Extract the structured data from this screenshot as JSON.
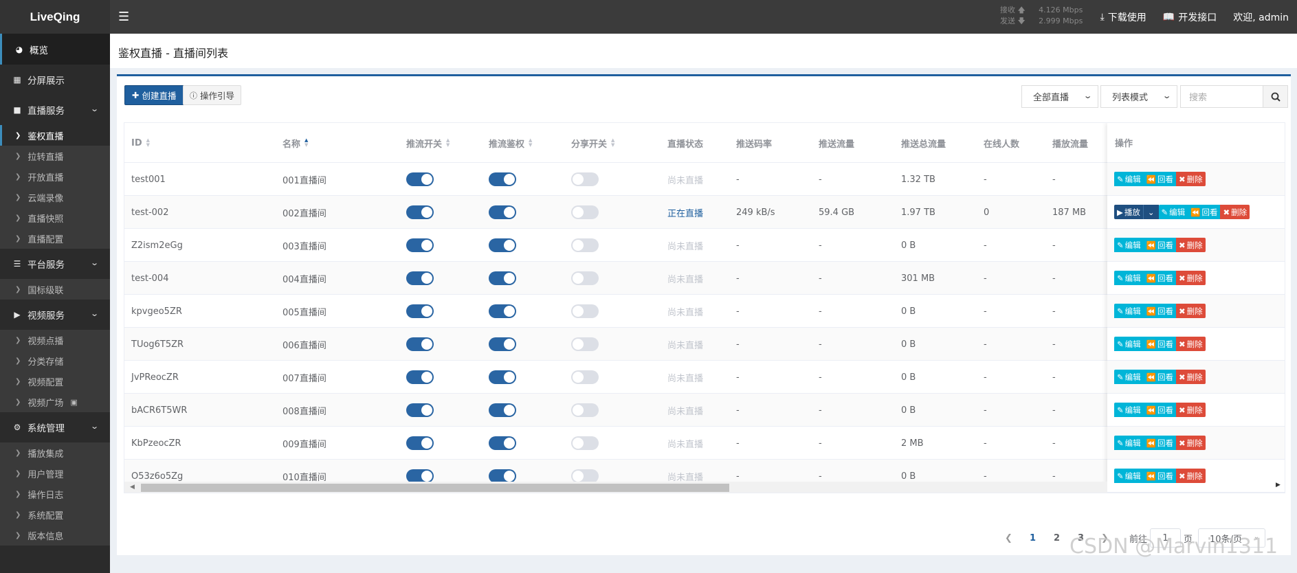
{
  "brand": "LiveQing",
  "topbar": {
    "recv_label": "接收",
    "recv_value": "4.126 Mbps",
    "send_label": "发送",
    "send_value": "2.999 Mbps",
    "download": "下载使用",
    "api": "开发接口",
    "welcome": "欢迎, admin"
  },
  "sidebar": {
    "overview": "概览",
    "split": "分屏展示",
    "live_service": "直播服务",
    "live_items": [
      "鉴权直播",
      "拉转直播",
      "开放直播",
      "云端录像",
      "直播快照",
      "直播配置"
    ],
    "platform_service": "平台服务",
    "platform_items": [
      "国标级联"
    ],
    "video_service": "视频服务",
    "video_items": [
      "视频点播",
      "分类存储",
      "视频配置",
      "视频广场"
    ],
    "system": "系统管理",
    "system_items": [
      "播放集成",
      "用户管理",
      "操作日志",
      "系统配置",
      "版本信息"
    ]
  },
  "page_title": "鉴权直播 - 直播间列表",
  "toolbar": {
    "create": "创建直播",
    "guide": "操作引导",
    "filter": "全部直播",
    "mode": "列表模式",
    "search_placeholder": "搜索"
  },
  "table": {
    "headers": [
      "ID",
      "名称",
      "推流开关",
      "推流鉴权",
      "分享开关",
      "直播状态",
      "推送码率",
      "推送流量",
      "推送总流量",
      "在线人数",
      "播放流量",
      "操作"
    ],
    "rows": [
      {
        "id": "test001",
        "name": "001直播间",
        "status": "尚未直播",
        "bitrate": "-",
        "traffic": "-",
        "total": "1.32 TB",
        "online": "-",
        "play": "-"
      },
      {
        "id": "test-002",
        "name": "002直播间",
        "status": "正在直播",
        "bitrate": "249 kB/s",
        "traffic": "59.4 GB",
        "total": "1.97 TB",
        "online": "0",
        "play": "187 MB"
      },
      {
        "id": "Z2ism2eGg",
        "name": "003直播间",
        "status": "尚未直播",
        "bitrate": "-",
        "traffic": "-",
        "total": "0 B",
        "online": "-",
        "play": "-"
      },
      {
        "id": "test-004",
        "name": "004直播间",
        "status": "尚未直播",
        "bitrate": "-",
        "traffic": "-",
        "total": "301 MB",
        "online": "-",
        "play": "-"
      },
      {
        "id": "kpvgeo5ZR",
        "name": "005直播间",
        "status": "尚未直播",
        "bitrate": "-",
        "traffic": "-",
        "total": "0 B",
        "online": "-",
        "play": "-"
      },
      {
        "id": "TUog6T5ZR",
        "name": "006直播间",
        "status": "尚未直播",
        "bitrate": "-",
        "traffic": "-",
        "total": "0 B",
        "online": "-",
        "play": "-"
      },
      {
        "id": "JvPReocZR",
        "name": "007直播间",
        "status": "尚未直播",
        "bitrate": "-",
        "traffic": "-",
        "total": "0 B",
        "online": "-",
        "play": "-"
      },
      {
        "id": "bACR6T5WR",
        "name": "008直播间",
        "status": "尚未直播",
        "bitrate": "-",
        "traffic": "-",
        "total": "0 B",
        "online": "-",
        "play": "-"
      },
      {
        "id": "KbPzeocZR",
        "name": "009直播间",
        "status": "尚未直播",
        "bitrate": "-",
        "traffic": "-",
        "total": "2 MB",
        "online": "-",
        "play": "-"
      },
      {
        "id": "O53z6o5Zg",
        "name": "010直播间",
        "status": "尚未直播",
        "bitrate": "-",
        "traffic": "-",
        "total": "0 B",
        "online": "-",
        "play": "-"
      }
    ],
    "ops": {
      "play": "播放",
      "edit": "编辑",
      "back": "回看",
      "del": "删除"
    }
  },
  "pagination": {
    "pages": [
      "1",
      "2",
      "3"
    ],
    "goto_label": "前往",
    "goto_value": "1",
    "page_unit": "页",
    "size": "10条/页"
  },
  "watermark": "CSDN @Marvin1311",
  "colors": {
    "primary": "#1f5f9e",
    "info": "#00b5d8",
    "danger": "#dd4b39"
  }
}
